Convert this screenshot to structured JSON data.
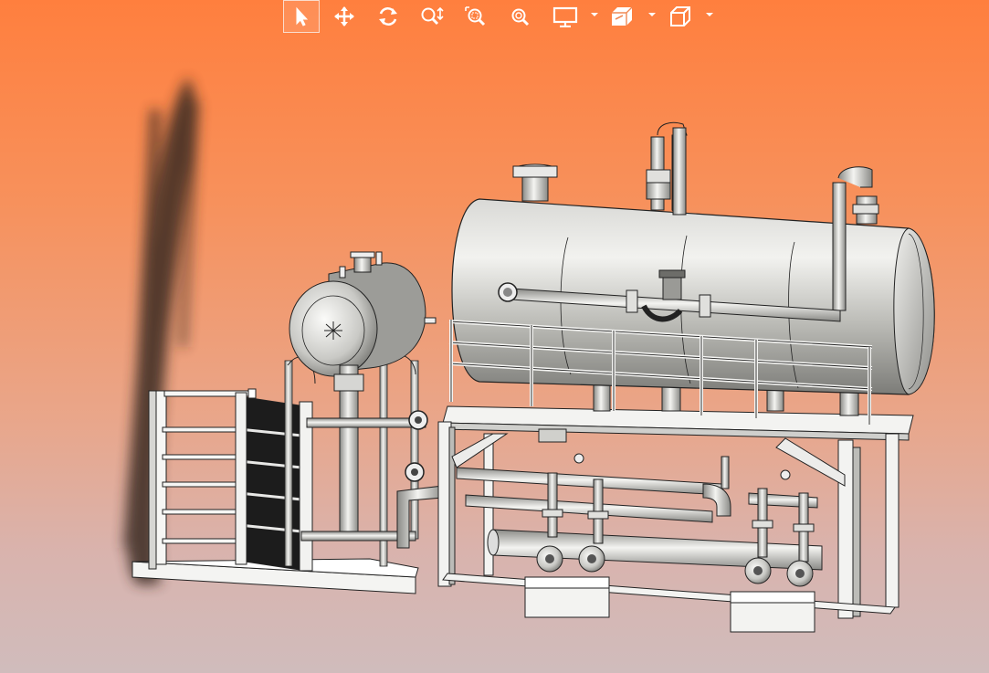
{
  "toolbar": {
    "items": [
      {
        "name": "select-tool",
        "icon": "select-arrow-icon",
        "active": true
      },
      {
        "name": "pan-tool",
        "icon": "pan-move-icon",
        "active": false
      },
      {
        "name": "rotate-tool",
        "icon": "rotate-orbit-icon",
        "active": false
      },
      {
        "name": "zoom-in-out-tool",
        "icon": "zoom-in-out-icon",
        "active": false
      },
      {
        "name": "zoom-window-tool",
        "icon": "zoom-window-icon",
        "active": false
      },
      {
        "name": "zoom-fit-tool",
        "icon": "zoom-fit-icon",
        "active": false
      },
      {
        "name": "display-mode-menu",
        "icon": "monitor-icon",
        "active": false,
        "has_dropdown": true
      },
      {
        "name": "section-view-menu",
        "icon": "section-box-icon",
        "active": false,
        "has_dropdown": true
      },
      {
        "name": "standard-views-menu",
        "icon": "view-cube-icon",
        "active": false,
        "has_dropdown": true
      }
    ]
  },
  "viewport": {
    "background_top": "#ff7f3e",
    "background_bottom": "#d0bcbc",
    "model": "deaerator-skid-assembly"
  },
  "colors": {
    "metal_light": "#e6e6e4",
    "metal_mid": "#b2b2ae",
    "metal_dark": "#6e6e6a",
    "outline": "#222222",
    "plate_dark": "#1c1c1c",
    "shadow": "#3a2a22"
  }
}
